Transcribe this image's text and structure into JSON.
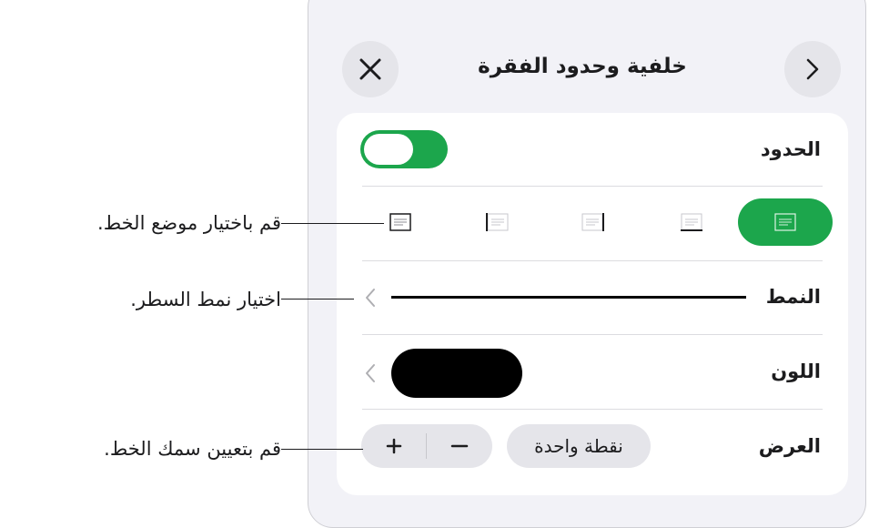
{
  "panel": {
    "title": "خلفية وحدود الفقرة",
    "close_icon": "close-icon",
    "forward_icon": "chevron-right-icon"
  },
  "borders": {
    "label": "الحدود",
    "toggle_on": true,
    "accent_color": "#1ca64c"
  },
  "position_options": [
    {
      "name": "all-borders",
      "selected": true
    },
    {
      "name": "bottom-border",
      "selected": false
    },
    {
      "name": "right-border",
      "selected": false
    },
    {
      "name": "left-border",
      "selected": false
    },
    {
      "name": "top-bottom-borders",
      "selected": false
    }
  ],
  "style_row": {
    "label": "النمط",
    "line": "solid"
  },
  "color_row": {
    "label": "اللون",
    "value": "#000000"
  },
  "width_row": {
    "label": "العرض",
    "value": "نقطة واحدة",
    "minus": "−",
    "plus": "+"
  },
  "callouts": {
    "position": "قم باختيار موضع الخط.",
    "style": "اختيار نمط السطر.",
    "width": "قم بتعيين سمك الخط."
  }
}
